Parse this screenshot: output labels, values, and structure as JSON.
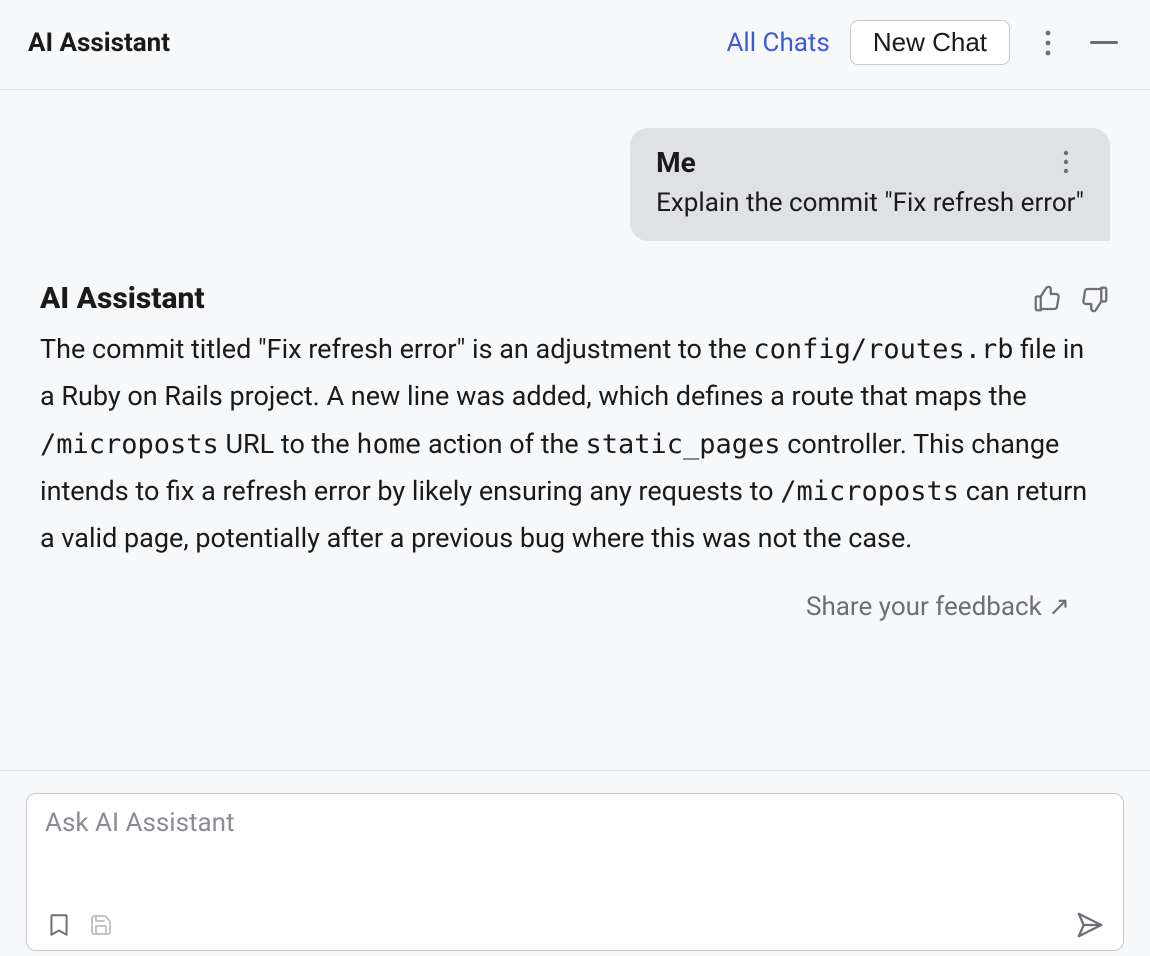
{
  "header": {
    "title": "AI Assistant",
    "all_chats": "All Chats",
    "new_chat": "New Chat"
  },
  "chat": {
    "user": {
      "name": "Me",
      "text": "Explain the commit \"Fix refresh error\""
    },
    "assistant": {
      "name": "AI Assistant",
      "body": {
        "p0": "The commit titled \"Fix refresh error\" is an adjustment to the ",
        "c0": "config/routes.rb",
        "p1": " file in a Ruby on Rails project. A new line was added, which defines a route that maps the ",
        "c1": "/microposts",
        "p2": " URL to the ",
        "c2": "home",
        "p3": " action of the ",
        "c3": "static_pages",
        "p4": " controller. This change intends to fix a refresh error by likely ensuring any requests to ",
        "c4": "/microposts",
        "p5": " can return a valid page, potentially after a previous bug where this was not the case."
      }
    }
  },
  "feedback": {
    "label": "Share your feedback ↗"
  },
  "input": {
    "placeholder": "Ask AI Assistant"
  }
}
